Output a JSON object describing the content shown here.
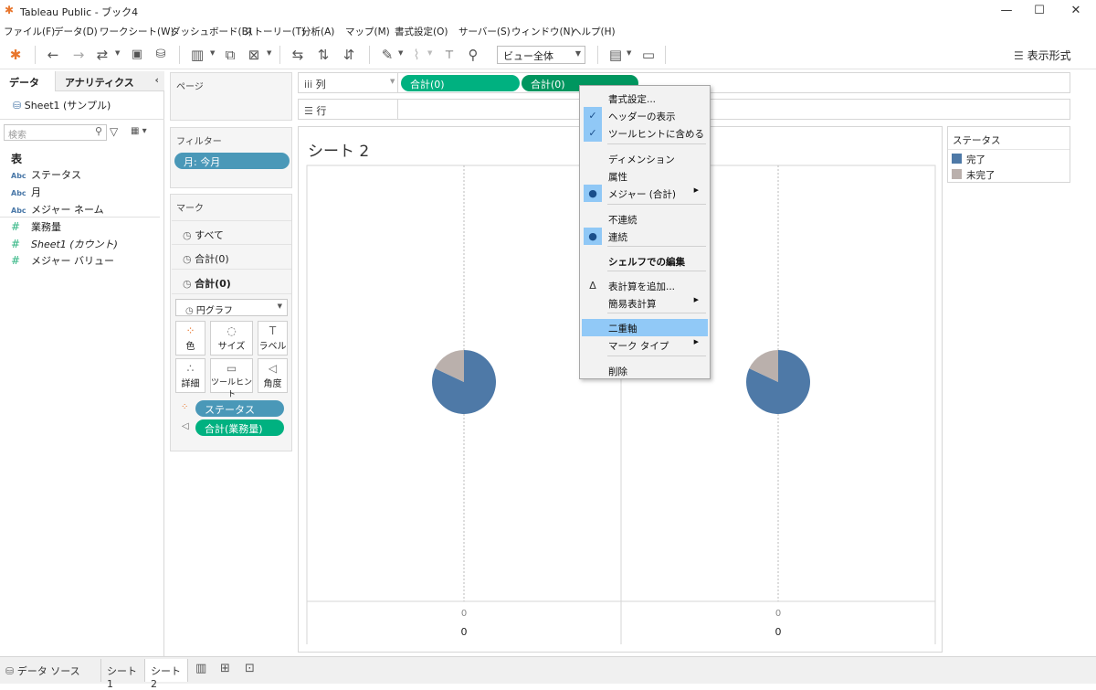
{
  "app": {
    "title": "Tableau Public - ブック4"
  },
  "window_controls": [
    "—",
    "☐",
    "✕"
  ],
  "menubar": [
    "ファイル(F)",
    "データ(D)",
    "ワークシート(W)",
    "ダッシュボード(B)",
    "ストーリー(T)",
    "分析(A)",
    "マップ(M)",
    "書式設定(O)",
    "サーバー(S)",
    "ウィンドウ(N)",
    "ヘルプ(H)"
  ],
  "toolbar": {
    "view_select": "ビュー全体",
    "show_me": "表示形式"
  },
  "datapane": {
    "tab_data": "データ",
    "tab_analytics": "アナリティクス",
    "datasource": "Sheet1 (サンプル)",
    "search_placeholder": "検索",
    "section_table": "表",
    "fields": [
      {
        "type": "Abc",
        "name": "ステータス"
      },
      {
        "type": "Abc",
        "name": "月"
      },
      {
        "type": "Abc",
        "name": "メジャー ネーム"
      },
      {
        "type": "#",
        "name": "業務量"
      },
      {
        "type": "#",
        "name": "Sheet1 (カウント)"
      },
      {
        "type": "#",
        "name": "メジャー バリュー"
      }
    ]
  },
  "pages": {
    "title": "ページ"
  },
  "filters": {
    "title": "フィルター",
    "pill": "月: 今月"
  },
  "marks": {
    "title": "マーク",
    "rows": [
      "すべて",
      "合計(0)",
      "合計(0)"
    ],
    "type": "円グラフ",
    "buttons": [
      "色",
      "サイズ",
      "ラベル",
      "詳細",
      "ツールヒント",
      "角度"
    ],
    "pill_color": "ステータス",
    "pill_angle": "合計(業務量)"
  },
  "shelves": {
    "columns_label": "列",
    "rows_label": "行",
    "column_pills": [
      "合計(0)",
      "合計(0)"
    ]
  },
  "view": {
    "title": "シート 2",
    "axis_ticks": [
      "0",
      "0"
    ],
    "axis_labels": [
      "0",
      "0"
    ]
  },
  "legend": {
    "title": "ステータス",
    "items": [
      {
        "label": "完了",
        "color": "#4e79a7"
      },
      {
        "label": "未完了",
        "color": "#bab0ac"
      }
    ]
  },
  "chart_data": [
    {
      "type": "pie",
      "categories": [
        "完了",
        "未完了"
      ],
      "values": [
        0.82,
        0.18
      ]
    },
    {
      "type": "pie",
      "categories": [
        "完了",
        "未完了"
      ],
      "values": [
        0.82,
        0.18
      ]
    }
  ],
  "context_menu": {
    "items": [
      {
        "label": "書式設定...",
        "check": "",
        "sub": false
      },
      {
        "label": "ヘッダーの表示",
        "check": "✓",
        "sub": false
      },
      {
        "label": "ツールヒントに含める",
        "check": "✓",
        "sub": false
      },
      {
        "label": "ディメンション",
        "check": "",
        "sub": false
      },
      {
        "label": "属性",
        "check": "",
        "sub": false
      },
      {
        "label": "メジャー (合計)",
        "check": "●",
        "sub": true
      },
      {
        "label": "不連続",
        "check": "",
        "sub": false
      },
      {
        "label": "連続",
        "check": "●",
        "sub": false
      },
      {
        "label": "シェルフでの編集",
        "check": "",
        "sub": false
      },
      {
        "label": "表計算を追加...",
        "check": "Δ",
        "sub": false
      },
      {
        "label": "簡易表計算",
        "check": "",
        "sub": true
      },
      {
        "label": "二重軸",
        "check": "",
        "sub": false
      },
      {
        "label": "マーク タイプ",
        "check": "",
        "sub": true
      },
      {
        "label": "削除",
        "check": "",
        "sub": false
      }
    ]
  },
  "bottom_tabs": {
    "datasource": "データ ソース",
    "sheet1": "シート 1",
    "sheet2": "シート 2"
  }
}
